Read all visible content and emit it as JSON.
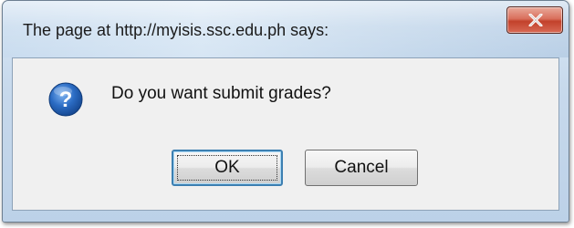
{
  "dialog": {
    "title": "The page at http://myisis.ssc.edu.ph says:",
    "message": "Do you want submit grades?",
    "icon": "question-icon",
    "close_label": "X"
  },
  "buttons": {
    "ok_label": "OK",
    "cancel_label": "Cancel"
  },
  "colors": {
    "titlebar": "#c9dcef",
    "close_button": "#c2412b",
    "question_icon": "#1f5fae",
    "default_button_border": "#3c7fb1"
  }
}
